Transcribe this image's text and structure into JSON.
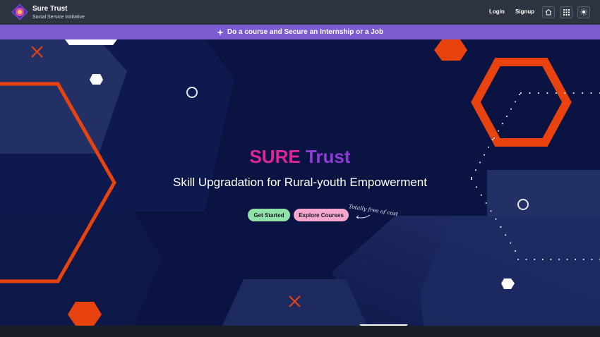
{
  "brand": {
    "title": "Sure Trust",
    "subtitle": "Social Service Inititative"
  },
  "nav": {
    "login": "Login",
    "signup": "Signup",
    "icons": [
      "home-icon",
      "grid-icon",
      "sun-icon"
    ]
  },
  "banner": {
    "text": "Do a course and Secure an Internship or a Job",
    "icon": "sparkle-icon"
  },
  "hero": {
    "title_part1": "SURE",
    "title_part2": "Trust",
    "subtitle": "Skill Upgradation for Rural-youth Empowerment",
    "get_started": "Get Started",
    "explore_courses": "Explore Courses",
    "free_note": "Totally free of cost"
  },
  "colors": {
    "navbar": "#2d3340",
    "banner": "#7b5bd0",
    "hero_bg": "#0a1342",
    "accent_orange": "#e8430f",
    "title_pink": "#e0249a",
    "title_purple": "#8e3ad6",
    "btn_green": "#8fe3a8",
    "btn_pink": "#f5a6cc"
  }
}
